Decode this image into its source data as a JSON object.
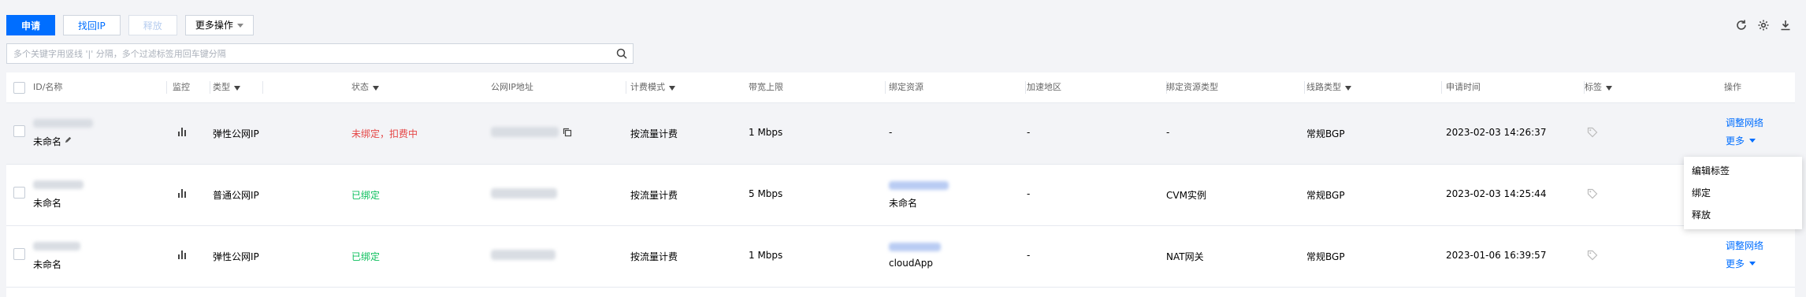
{
  "toolbar": {
    "apply": "申请",
    "retrieve_ip": "找回IP",
    "release": "释放",
    "more_actions": "更多操作"
  },
  "search": {
    "placeholder": "多个关键字用竖线 '|' 分隔，多个过滤标签用回车键分隔"
  },
  "table": {
    "headers": {
      "id_name": "ID/名称",
      "monitor": "监控",
      "type": "类型",
      "status": "状态",
      "public_ip": "公网IP地址",
      "billing": "计费模式",
      "bandwidth": "带宽上限",
      "bound_resource": "绑定资源",
      "accel_region": "加速地区",
      "bound_resource_type": "绑定资源类型",
      "line_type": "线路类型",
      "apply_time": "申请时间",
      "tags": "标签",
      "actions": "操作"
    },
    "rows": [
      {
        "name": "未命名",
        "type": "弹性公网IP",
        "status": "未绑定，扣费中",
        "billing": "按流量计费",
        "bandwidth": "1 Mbps",
        "bound_resource": "-",
        "accel_region": "-",
        "bound_resource_type": "-",
        "line_type": "常规BGP",
        "apply_time": "2023-02-03 14:26:37",
        "action_adjust": "调整网络",
        "action_more": "更多"
      },
      {
        "name": "未命名",
        "type": "普通公网IP",
        "status": "已绑定",
        "billing": "按流量计费",
        "bandwidth": "5 Mbps",
        "bound_resource": "未命名",
        "accel_region": "-",
        "bound_resource_type": "CVM实例",
        "line_type": "常规BGP",
        "apply_time": "2023-02-03 14:25:44"
      },
      {
        "name": "未命名",
        "type": "弹性公网IP",
        "status": "已绑定",
        "billing": "按流量计费",
        "bandwidth": "1 Mbps",
        "bound_resource": "cloudApp",
        "accel_region": "-",
        "bound_resource_type": "NAT网关",
        "line_type": "常规BGP",
        "apply_time": "2023-01-06 16:39:57",
        "action_adjust": "调整网络",
        "action_more": "更多"
      }
    ]
  },
  "dropdown_menu": {
    "items": [
      "编辑标签",
      "绑定",
      "释放"
    ]
  },
  "colors": {
    "primary": "#006eff",
    "danger": "#e54545",
    "success": "#0abf5b"
  }
}
